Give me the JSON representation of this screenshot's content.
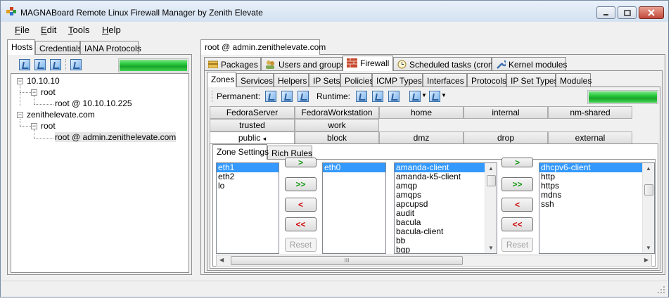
{
  "window": {
    "title": "MAGNABoard Remote Linux Firewall Manager by Zenith Elevate"
  },
  "menu": [
    "File",
    "Edit",
    "Tools",
    "Help"
  ],
  "left_tabs": [
    "Hosts",
    "Credentials",
    "IANA Protocols"
  ],
  "tree": {
    "nodes": [
      "10.10.10",
      "root",
      "root @ 10.10.10.225",
      "zenithelevate.com",
      "root",
      "root @ admin.zenithelevate.com"
    ]
  },
  "progress_left": {
    "value": 1.0
  },
  "host_tab": "root @ admin.zenithelevate.com",
  "main_tabs": [
    "Packages",
    "Users and groups",
    "Firewall",
    "Scheduled tasks (cron)",
    "Kernel modules"
  ],
  "firewall_tabs": [
    "Zones",
    "Services",
    "Helpers",
    "IP Sets",
    "Policies",
    "ICMP Types",
    "Interfaces",
    "Protocols",
    "IP Set Types",
    "Modules"
  ],
  "toolbar": {
    "permanent_label": "Permanent:",
    "runtime_label": "Runtime:"
  },
  "progress_right": {
    "value": 1.0
  },
  "zones": {
    "row1": [
      "FedoraServer",
      "FedoraWorkstation",
      "home",
      "internal",
      "nm-shared"
    ],
    "row2": [
      "trusted",
      "work"
    ],
    "row3": [
      "public",
      "block",
      "dmz",
      "drop",
      "external"
    ],
    "active_marker": "◂"
  },
  "zone_tabs": [
    "Zone Settings",
    "Rich Rules"
  ],
  "interfaces_available": [
    "eth1",
    "eth2",
    "lo"
  ],
  "interfaces_assigned": [
    "eth0"
  ],
  "services_available": [
    "amanda-client",
    "amanda-k5-client",
    "amqp",
    "amqps",
    "apcupsd",
    "audit",
    "bacula",
    "bacula-client",
    "bb",
    "bgp"
  ],
  "services_assigned": [
    "dhcpv6-client",
    "http",
    "https",
    "mdns",
    "ssh"
  ],
  "buttons": {
    "add": ">",
    "add_all": ">>",
    "remove": "<",
    "remove_all": "<<",
    "reset": "Reset"
  },
  "scroll": {
    "grip": "III"
  }
}
